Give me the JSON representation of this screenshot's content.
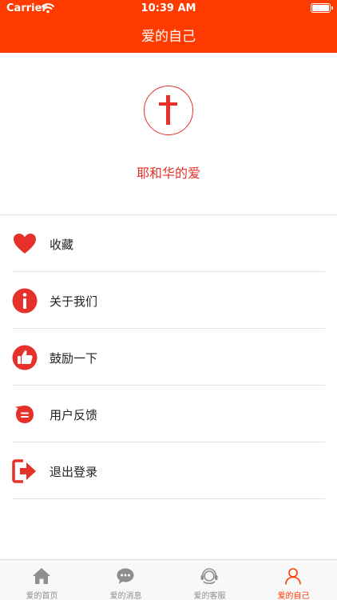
{
  "status_bar": {
    "carrier": "Carrier",
    "time": "10:39 AM"
  },
  "header": {
    "title": "爱的自己"
  },
  "profile": {
    "name": "耶和华的爱"
  },
  "menu": {
    "items": [
      {
        "label": "收藏",
        "icon": "heart-icon"
      },
      {
        "label": "关于我们",
        "icon": "info-icon"
      },
      {
        "label": "鼓励一下",
        "icon": "thumbs-up-icon"
      },
      {
        "label": "用户反馈",
        "icon": "feedback-icon"
      },
      {
        "label": "退出登录",
        "icon": "logout-icon"
      }
    ]
  },
  "tabbar": {
    "items": [
      {
        "label": "爱的首页",
        "icon": "home-icon"
      },
      {
        "label": "爱的消息",
        "icon": "chat-icon"
      },
      {
        "label": "爱的客服",
        "icon": "headset-icon"
      },
      {
        "label": "爱的自己",
        "icon": "user-icon"
      }
    ],
    "active_index": 3
  },
  "colors": {
    "accent": "#ff3b00",
    "icon_red": "#e6302a",
    "inactive": "#8e8e8e"
  }
}
